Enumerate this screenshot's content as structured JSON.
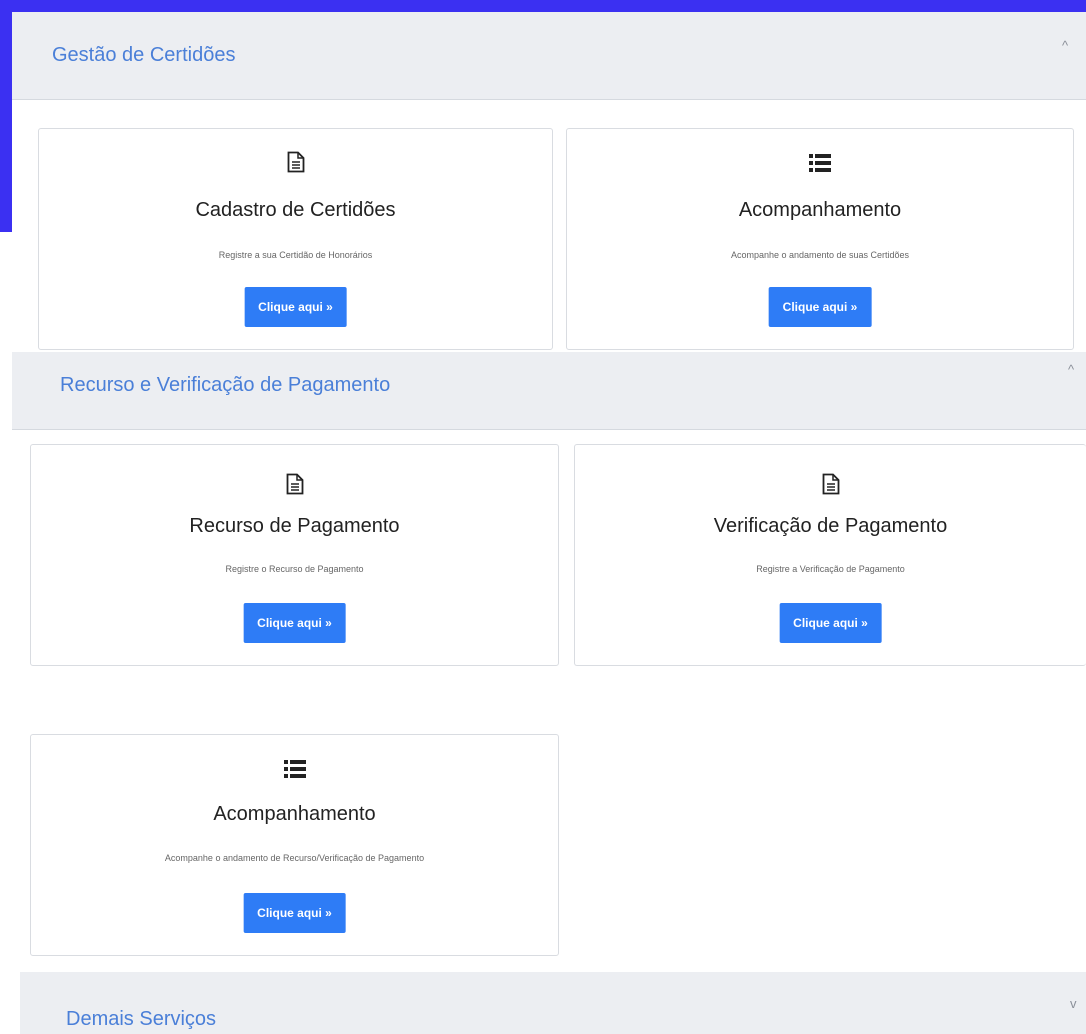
{
  "colors": {
    "frame": "#3b30f2",
    "accent_text": "#4a7fd8",
    "button": "#2e7cf6",
    "header_bg": "#eceef2"
  },
  "sections": [
    {
      "title": "Gestão de Certidões",
      "chevron": "^"
    },
    {
      "title": "Recurso e Verificação de Pagamento",
      "chevron": "^"
    },
    {
      "title": "Demais Serviços",
      "chevron": "v"
    }
  ],
  "cards": [
    {
      "icon": "document-icon",
      "title": "Cadastro de Certidões",
      "desc": "Registre a sua Certidão de Honorários",
      "button": "Clique aqui »"
    },
    {
      "icon": "list-icon",
      "title": "Acompanhamento",
      "desc": "Acompanhe o andamento de suas Certidões",
      "button": "Clique aqui »"
    },
    {
      "icon": "document-icon",
      "title": "Recurso de Pagamento",
      "desc": "Registre o Recurso de Pagamento",
      "button": "Clique aqui »"
    },
    {
      "icon": "document-icon",
      "title": "Verificação de Pagamento",
      "desc": "Registre a Verificação de Pagamento",
      "button": "Clique aqui »"
    },
    {
      "icon": "list-icon",
      "title": "Acompanhamento",
      "desc": "Acompanhe o andamento de Recurso/Verificação de Pagamento",
      "button": "Clique aqui »"
    }
  ]
}
